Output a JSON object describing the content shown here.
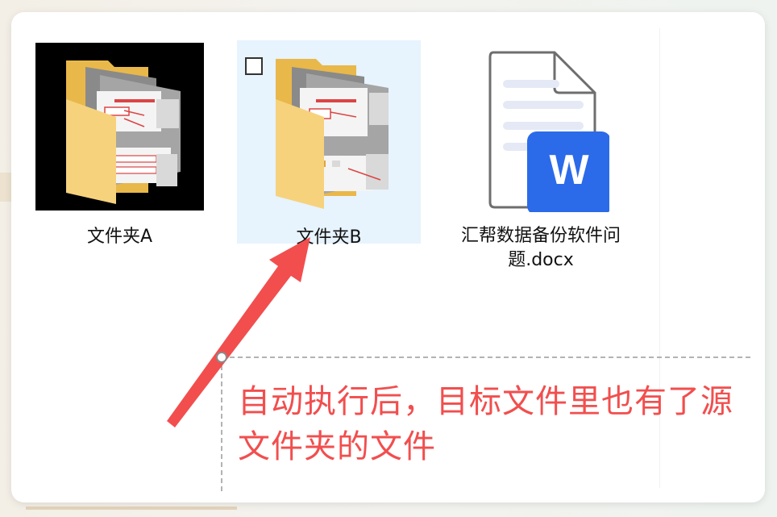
{
  "files": [
    {
      "name": "文件夹A",
      "icon": "folder-icon",
      "type": "folder",
      "selected": false
    },
    {
      "name": "文件夹B",
      "icon": "folder-icon",
      "type": "folder",
      "selected": true,
      "hover": true
    },
    {
      "name": "汇帮数据备份软件问题.docx",
      "icon": "word-document-icon",
      "type": "docx",
      "selected": false
    }
  ],
  "doc_badge": "W",
  "annotation": {
    "text": "自动执行后，目标文件里也有了源文件夹的文件"
  },
  "colors": {
    "accent_red": "#f24e4e",
    "selection_bg": "#e7f3fd",
    "word_blue": "#2b6be9",
    "folder_yellow": "#f6d27d"
  }
}
